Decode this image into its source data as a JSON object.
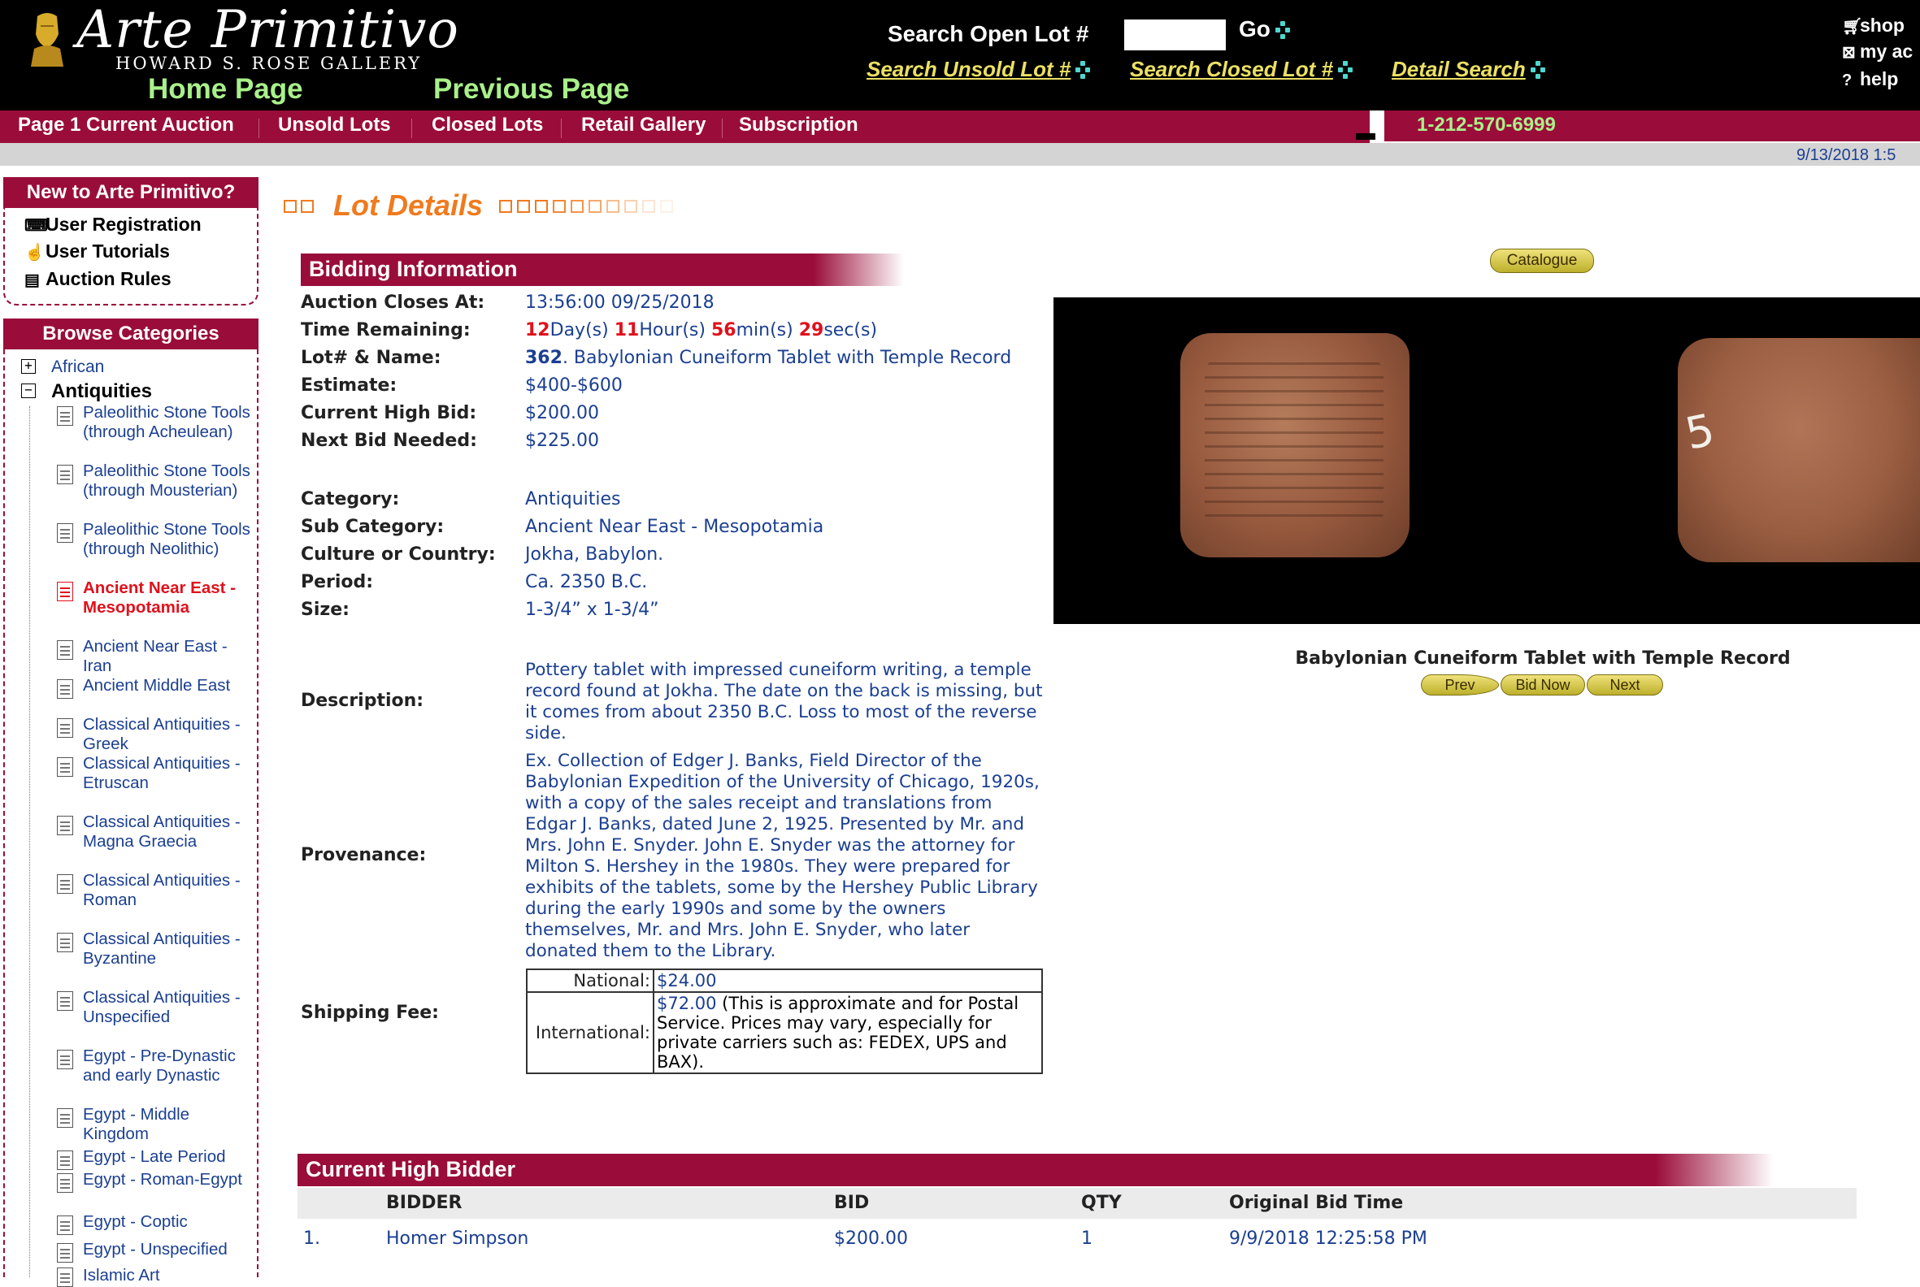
{
  "header": {
    "logo_title": "Arte Primitivo",
    "logo_subtitle": "HOWARD S. ROSE GALLERY",
    "home_link": "Home Page",
    "previous_link": "Previous Page",
    "search_open_label": "Search Open Lot #",
    "search_open_value": "",
    "go_label": "Go",
    "search_unsold": "Search Unsold Lot #",
    "search_closed": "Search Closed Lot #",
    "detail_search": "Detail Search",
    "shop_link": "shop",
    "myac_link": "my ac",
    "help_link": "help",
    "phone": "1-212-570-6999",
    "date": "9/13/2018 1:5"
  },
  "nav": [
    "Page 1 Current Auction",
    "Unsold Lots",
    "Closed Lots",
    "Retail Gallery",
    "Subscription"
  ],
  "sidebar": {
    "new_heading": "New to Arte Primitivo?",
    "links": [
      "User Registration",
      "User Tutorials",
      "Auction Rules"
    ],
    "browse_heading": "Browse Categories",
    "top_categories": [
      "African",
      "Antiquities"
    ],
    "subcategories": [
      "Paleolithic Stone Tools (through Acheulean)",
      "Paleolithic Stone Tools (through Mousterian)",
      "Paleolithic Stone Tools (through Neolithic)",
      "Ancient Near East - Mesopotamia",
      "Ancient Near East - Iran",
      "Ancient Middle East",
      "Classical Antiquities - Greek",
      "Classical Antiquities - Etruscan",
      "Classical Antiquities - Magna Graecia",
      "Classical Antiquities - Roman",
      "Classical Antiquities - Byzantine",
      "Classical Antiquities - Unspecified",
      "Egypt - Pre-Dynastic and early Dynastic",
      "Egypt - Middle Kingdom",
      "Egypt - Late Period",
      "Egypt - Roman-Egypt",
      "Egypt - Coptic",
      "Egypt - Unspecified",
      "Islamic Art"
    ],
    "active_subcategory": "Ancient Near East - Mesopotamia"
  },
  "main": {
    "lot_details_title": "Lot Details",
    "bidding_heading": "Bidding Information",
    "labels": {
      "closes": "Auction Closes At:",
      "remaining": "Time Remaining:",
      "lot_name": "Lot# & Name:",
      "estimate": "Estimate:",
      "current_bid": "Current High Bid:",
      "next_bid": "Next Bid Needed:",
      "category": "Category:",
      "sub_category": "Sub Category:",
      "culture": "Culture or Country:",
      "period": "Period:",
      "size": "Size:",
      "description": "Description:",
      "provenance": "Provenance:",
      "shipping": "Shipping Fee:"
    },
    "values": {
      "closes": "13:56:00 09/25/2018",
      "remaining_days": "12",
      "remaining_days_unit": "Day(s)",
      "remaining_hours": "11",
      "remaining_hours_unit": "Hour(s)",
      "remaining_min": "56",
      "remaining_min_unit": "min(s)",
      "remaining_sec": "29",
      "remaining_sec_unit": "sec(s)",
      "lot_number": "362",
      "lot_name": ". Babylonian Cuneiform Tablet with Temple Record",
      "estimate": "$400-$600",
      "current_bid": "$200.00",
      "next_bid": "$225.00",
      "category": "Antiquities",
      "sub_category": "Ancient Near East - Mesopotamia",
      "culture": "Jokha, Babylon.",
      "period": "Ca. 2350 B.C.",
      "size": "1-3/4” x 1-3/4”",
      "description": "Pottery tablet with impressed cuneiform writing, a temple record found at Jokha. The date on the back is missing, but it comes from about 2350 B.C. Loss to most of the reverse side.",
      "provenance": "Ex. Collection of Edger J. Banks, Field Director of the Babylonian Expedition of the University of Chicago, 1920s, with a copy of the sales receipt and translations from Edgar J. Banks, dated June 2, 1925. Presented by Mr. and Mrs. John E. Snyder. John E. Snyder was the attorney for Milton S. Hershey in the 1980s. They were prepared for exhibits of the tablets, some by the Hershey Public Library during the early 1990s and some by the owners themselves, Mr. and Mrs. John E. Snyder, who later donated them to the Library."
    },
    "shipping": {
      "national_label": "National:",
      "national_value": "$24.00",
      "international_label": "International:",
      "international_value": "$72.00",
      "international_note": " (This is approximate and for Postal Service. Prices may vary, especially for private carriers such as: FEDEX, UPS and BAX)."
    }
  },
  "image_panel": {
    "catalogue_button": "Catalogue",
    "tablet_mark": "5",
    "caption": "Babylonian Cuneiform Tablet with Temple Record",
    "prev_button": "Prev",
    "bid_now_button": "Bid Now",
    "next_button": "Next"
  },
  "high_bidder": {
    "heading": "Current High Bidder",
    "columns": [
      "BIDDER",
      "BID",
      "QTY",
      "Original Bid Time"
    ],
    "rows": [
      {
        "rank": "1.",
        "bidder": "Homer Simpson",
        "bid": "$200.00",
        "qty": "1",
        "time": "9/9/2018 12:25:58 PM"
      }
    ]
  }
}
